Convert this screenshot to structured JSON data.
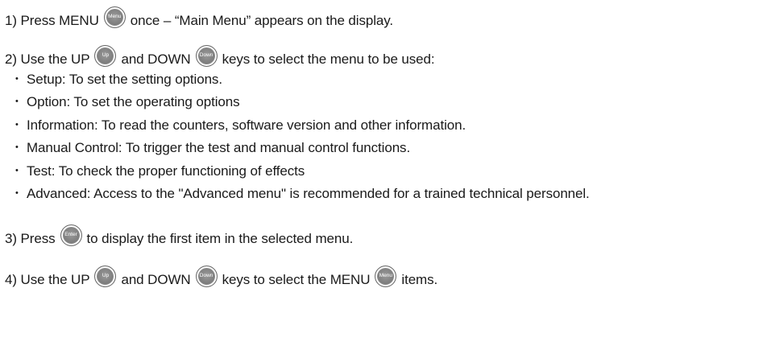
{
  "steps": {
    "s1": {
      "prefix": "1) Press MENU",
      "key": "Menu",
      "suffix": "once – “Main Menu” appears on the display."
    },
    "s2": {
      "prefix": "2) Use the UP",
      "key_up": "Up",
      "middle": "and DOWN",
      "key_down": "Down",
      "suffix": "keys to select the menu to be used:",
      "bullets": [
        "Setup: To set the setting options.",
        "Option: To set the operating options",
        "Information: To read the counters, software version and other  information.",
        "Manual Control: To trigger the test and manual control functions.",
        "Test: To check the proper functioning of  effects",
        "Advanced: Access to the \"Advanced menu\" is recommended for a trained technical personnel."
      ]
    },
    "s3": {
      "prefix": "3) Press",
      "key": "Enter",
      "suffix": "to display the first item in the selected menu."
    },
    "s4": {
      "prefix": "4) Use the UP",
      "key_up": "Up",
      "middle": "and DOWN",
      "key_down": "Down",
      "mid2": "keys to select the MENU",
      "key_menu": "Menu",
      "suffix": "items."
    }
  },
  "bullet_glyph": "•",
  "icons": {
    "key_button": "round-key-button-icon"
  },
  "colors": {
    "text": "#1a1a1a",
    "key_fill": "#7d7d7d",
    "key_label": "#ffffff"
  }
}
